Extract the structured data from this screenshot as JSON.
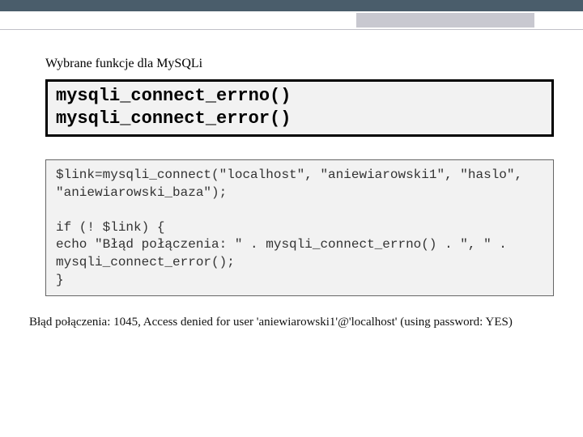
{
  "section_title": "Wybrane funkcje dla MySQLi",
  "functions": {
    "line1": "mysqli_connect_errno()",
    "line2": "mysqli_connect_error()"
  },
  "code": "$link=mysqli_connect(\"localhost\", \"aniewiarowski1\", \"haslo\", \"aniewiarowski_baza\");\n\nif (! $link) {\necho \"Błąd połączenia: \" . mysqli_connect_errno() . \", \" . mysqli_connect_error();\n}",
  "output": "Błąd połączenia: 1045, Access denied for user 'aniewiarowski1'@'localhost' (using password: YES)"
}
